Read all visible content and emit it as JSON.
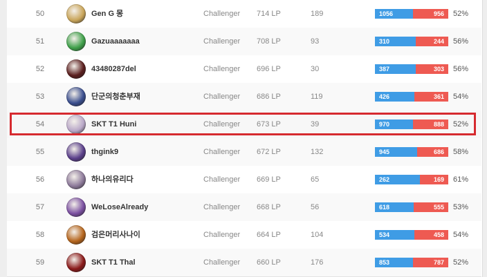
{
  "rows": [
    {
      "rank": "50",
      "name": "Gen G 몽",
      "tier": "Challenger",
      "lp": "714 LP",
      "games": "189",
      "wins": "1056",
      "losses": "956",
      "win_fraction": 0.52,
      "pct": "52%",
      "avatar_color": "#c9a55a"
    },
    {
      "rank": "51",
      "name": "Gazuaaaaaaa",
      "tier": "Challenger",
      "lp": "708 LP",
      "games": "93",
      "wins": "310",
      "losses": "244",
      "win_fraction": 0.56,
      "pct": "56%",
      "avatar_color": "#3fa04a"
    },
    {
      "rank": "52",
      "name": "43480287del",
      "tier": "Challenger",
      "lp": "696 LP",
      "games": "30",
      "wins": "387",
      "losses": "303",
      "win_fraction": 0.56,
      "pct": "56%",
      "avatar_color": "#5a1e1e"
    },
    {
      "rank": "53",
      "name": "단군의청춘부재",
      "tier": "Challenger",
      "lp": "686 LP",
      "games": "119",
      "wins": "426",
      "losses": "361",
      "win_fraction": 0.54,
      "pct": "54%",
      "avatar_color": "#3a4e8e"
    },
    {
      "rank": "54",
      "name": "SKT T1 Huni",
      "tier": "Challenger",
      "lp": "673 LP",
      "games": "39",
      "wins": "970",
      "losses": "888",
      "win_fraction": 0.52,
      "pct": "52%",
      "avatar_color": "#b9a8c8"
    },
    {
      "rank": "55",
      "name": "thgink9",
      "tier": "Challenger",
      "lp": "672 LP",
      "games": "132",
      "wins": "945",
      "losses": "686",
      "win_fraction": 0.58,
      "pct": "58%",
      "avatar_color": "#5a3f8a"
    },
    {
      "rank": "56",
      "name": "하나의유리다",
      "tier": "Challenger",
      "lp": "669 LP",
      "games": "65",
      "wins": "262",
      "losses": "169",
      "win_fraction": 0.61,
      "pct": "61%",
      "avatar_color": "#8d7a9a"
    },
    {
      "rank": "57",
      "name": "WeLoseAlready",
      "tier": "Challenger",
      "lp": "668 LP",
      "games": "56",
      "wins": "618",
      "losses": "555",
      "win_fraction": 0.53,
      "pct": "53%",
      "avatar_color": "#7a4fa0"
    },
    {
      "rank": "58",
      "name": "검은머리사나이",
      "tier": "Challenger",
      "lp": "664 LP",
      "games": "104",
      "wins": "534",
      "losses": "458",
      "win_fraction": 0.54,
      "pct": "54%",
      "avatar_color": "#b5651d"
    },
    {
      "rank": "59",
      "name": "SKT T1 Thal",
      "tier": "Challenger",
      "lp": "660 LP",
      "games": "176",
      "wins": "853",
      "losses": "787",
      "win_fraction": 0.52,
      "pct": "52%",
      "avatar_color": "#8a1a1a"
    }
  ],
  "highlighted_rank": "54",
  "colors": {
    "win": "#3f9ce5",
    "loss": "#ee5a52",
    "highlight_border": "#d62a2f"
  }
}
